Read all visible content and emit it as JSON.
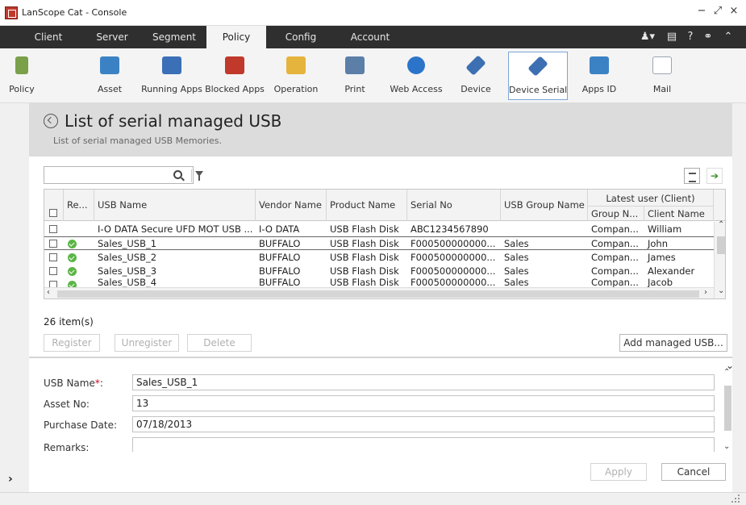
{
  "window": {
    "title": "LanScope Cat - Console",
    "controls": [
      "−",
      "⤢",
      "×"
    ]
  },
  "menu": {
    "tabs": [
      "Client",
      "Server",
      "Segment",
      "Policy",
      "Config",
      "Account"
    ],
    "active_tab": "Policy"
  },
  "toolbar": {
    "items": [
      {
        "label": "Policy",
        "icon": "policy-icon",
        "color": "#7aa04a"
      },
      {
        "label": "Asset",
        "icon": "asset-icon",
        "color": "#3b82c4"
      },
      {
        "label": "Running Apps",
        "icon": "running-apps-icon",
        "color": "#3b6fb6"
      },
      {
        "label": "Blocked Apps",
        "icon": "blocked-apps-icon",
        "color": "#c0392b"
      },
      {
        "label": "Operation",
        "icon": "operation-icon",
        "color": "#e5b43c"
      },
      {
        "label": "Print",
        "icon": "print-icon",
        "color": "#5c7fa8"
      },
      {
        "label": "Web Access",
        "icon": "web-access-icon",
        "color": "#2c74c9"
      },
      {
        "label": "Device",
        "icon": "device-icon",
        "color": "#3d6fb3"
      },
      {
        "label": "Device Serial",
        "icon": "device-serial-icon",
        "color": "#3d6fb3"
      },
      {
        "label": "Apps ID",
        "icon": "apps-id-icon",
        "color": "#3b82c4"
      },
      {
        "label": "Mail",
        "icon": "mail-icon",
        "color": "#9aa5b4"
      }
    ],
    "selected": "Device Serial"
  },
  "header": {
    "title": "List of serial managed USB",
    "subtitle": "List of serial managed USB Memories."
  },
  "grid": {
    "group_header": "Latest user (Client)",
    "columns": [
      "Re...",
      "USB Name",
      "Vendor Name",
      "Product Name",
      "Serial No",
      "USB Group Name",
      "Group N...",
      "Client Name"
    ],
    "rows": [
      {
        "registered": false,
        "usb_name": "I-O DATA Secure UFD MOT USB ...",
        "vendor": "I-O DATA",
        "product": "USB Flash Disk",
        "serial": "ABC1234567890",
        "group": "",
        "group_n": "Compan...",
        "client": "William"
      },
      {
        "registered": true,
        "usb_name": "Sales_USB_1",
        "vendor": "BUFFALO",
        "product": "USB Flash Disk",
        "serial": "F000500000000...",
        "group": "Sales",
        "group_n": "Compan...",
        "client": "John"
      },
      {
        "registered": true,
        "usb_name": "Sales_USB_2",
        "vendor": "BUFFALO",
        "product": "USB Flash Disk",
        "serial": "F000500000000...",
        "group": "Sales",
        "group_n": "Compan...",
        "client": "James"
      },
      {
        "registered": true,
        "usb_name": "Sales_USB_3",
        "vendor": "BUFFALO",
        "product": "USB Flash Disk",
        "serial": "F000500000000...",
        "group": "Sales",
        "group_n": "Compan...",
        "client": "Alexander"
      },
      {
        "registered": true,
        "usb_name": "Sales_USB_4",
        "vendor": "BUFFALO",
        "product": "USB Flash Disk",
        "serial": "F000500000000...",
        "group": "Sales",
        "group_n": "Compan...",
        "client": "Jacob"
      }
    ],
    "selected_index": 1,
    "item_count": "26 item(s)"
  },
  "actions": {
    "register": "Register",
    "unregister": "Unregister",
    "delete": "Delete",
    "add": "Add managed USB..."
  },
  "details": {
    "usb_name_label": "USB Name",
    "usb_name_required": "*",
    "usb_name_colon": ":",
    "usb_name_value": "Sales_USB_1",
    "asset_no_label": "Asset No:",
    "asset_no_value": "13",
    "purchase_date_label": "Purchase Date:",
    "purchase_date_value": "07/18/2013",
    "remarks_label": "Remarks:",
    "remarks_value": "",
    "apply": "Apply",
    "cancel": "Cancel"
  }
}
